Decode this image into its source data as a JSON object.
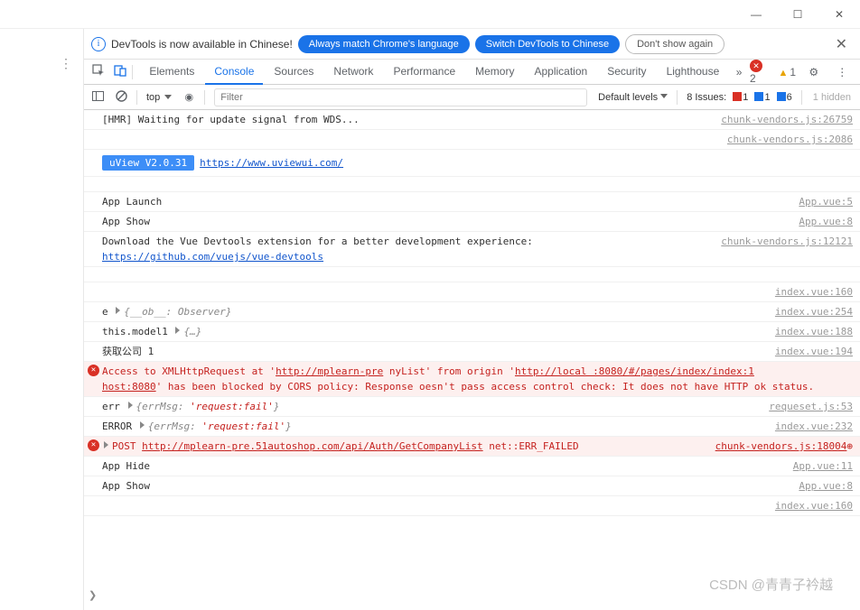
{
  "window": {
    "min": "—",
    "max": "☐",
    "close": "✕"
  },
  "infobar": {
    "text": "DevTools is now available in Chinese!",
    "btn1": "Always match Chrome's language",
    "btn2": "Switch DevTools to Chinese",
    "btn3": "Don't show again"
  },
  "tabs": [
    "Elements",
    "Console",
    "Sources",
    "Network",
    "Performance",
    "Memory",
    "Application",
    "Security",
    "Lighthouse"
  ],
  "active_tab": "Console",
  "status": {
    "errors": "2",
    "warnings": "1"
  },
  "filter": {
    "context": "top",
    "placeholder": "Filter",
    "levels": "Default levels",
    "issues_label": "8 Issues:",
    "issue_red": "1",
    "issue_blue1": "1",
    "issue_blue2": "6",
    "hidden": "1 hidden"
  },
  "rows": [
    {
      "type": "plain",
      "msg": "[HMR] Waiting for update signal from WDS...",
      "src": "chunk-vendors.js:26759"
    },
    {
      "type": "srconly",
      "src": "chunk-vendors.js:2086"
    },
    {
      "type": "uview",
      "badge": "uView V2.0.31",
      "link": "https://www.uviewui.com/"
    },
    {
      "type": "plain",
      "msg": "App Launch",
      "src": "App.vue:5"
    },
    {
      "type": "plain",
      "msg": "App Show",
      "src": "App.vue:8"
    },
    {
      "type": "devtools",
      "msg": "Download the Vue Devtools extension for a better development experience:",
      "link": "https://github.com/vuejs/vue-devtools",
      "src": "chunk-vendors.js:12121"
    },
    {
      "type": "srconly",
      "src": "index.vue:160"
    },
    {
      "type": "expand",
      "prefix": "e ",
      "obj": "{__ob__: Observer}",
      "src": "index.vue:254"
    },
    {
      "type": "expand",
      "prefix": "this.model1 ",
      "obj": "{…}",
      "src": "index.vue:188"
    },
    {
      "type": "plain",
      "msg": "获取公司 1",
      "src": "index.vue:194"
    },
    {
      "type": "cors",
      "pre": "Access to XMLHttpRequest at '",
      "url1": "http://mplearn-pre",
      "mid1": "                                    nyList",
      "mid2": "' from origin '",
      "url2": "http://local  :8080/#/pages/index/index:1",
      "line2": "host:8080",
      "tail": "' has been blocked by CORS policy: Response                          oesn't pass access control check: It does not have HTTP ok status."
    },
    {
      "type": "errmsg",
      "prefix": "err ",
      "obj": "{errMsg: ",
      "val": "'request:fail'",
      "close": "}",
      "src": "requeset.js:53"
    },
    {
      "type": "errmsg",
      "prefix": "ERROR ",
      "obj": "{errMsg: ",
      "val": "'request:fail'",
      "close": "}",
      "src": "index.vue:232"
    },
    {
      "type": "post",
      "method": "POST ",
      "url": "http://mplearn-pre.51autoshop.com/api/Auth/GetCompanyList",
      "tail": " net::ERR_FAILED",
      "src": "chunk-vendors.js:18004"
    },
    {
      "type": "plain",
      "msg": "App Hide",
      "src": "App.vue:11"
    },
    {
      "type": "plain",
      "msg": "App Show",
      "src": "App.vue:8"
    },
    {
      "type": "srconly",
      "src": "index.vue:160"
    }
  ],
  "watermark": "CSDN @青青子衿越"
}
